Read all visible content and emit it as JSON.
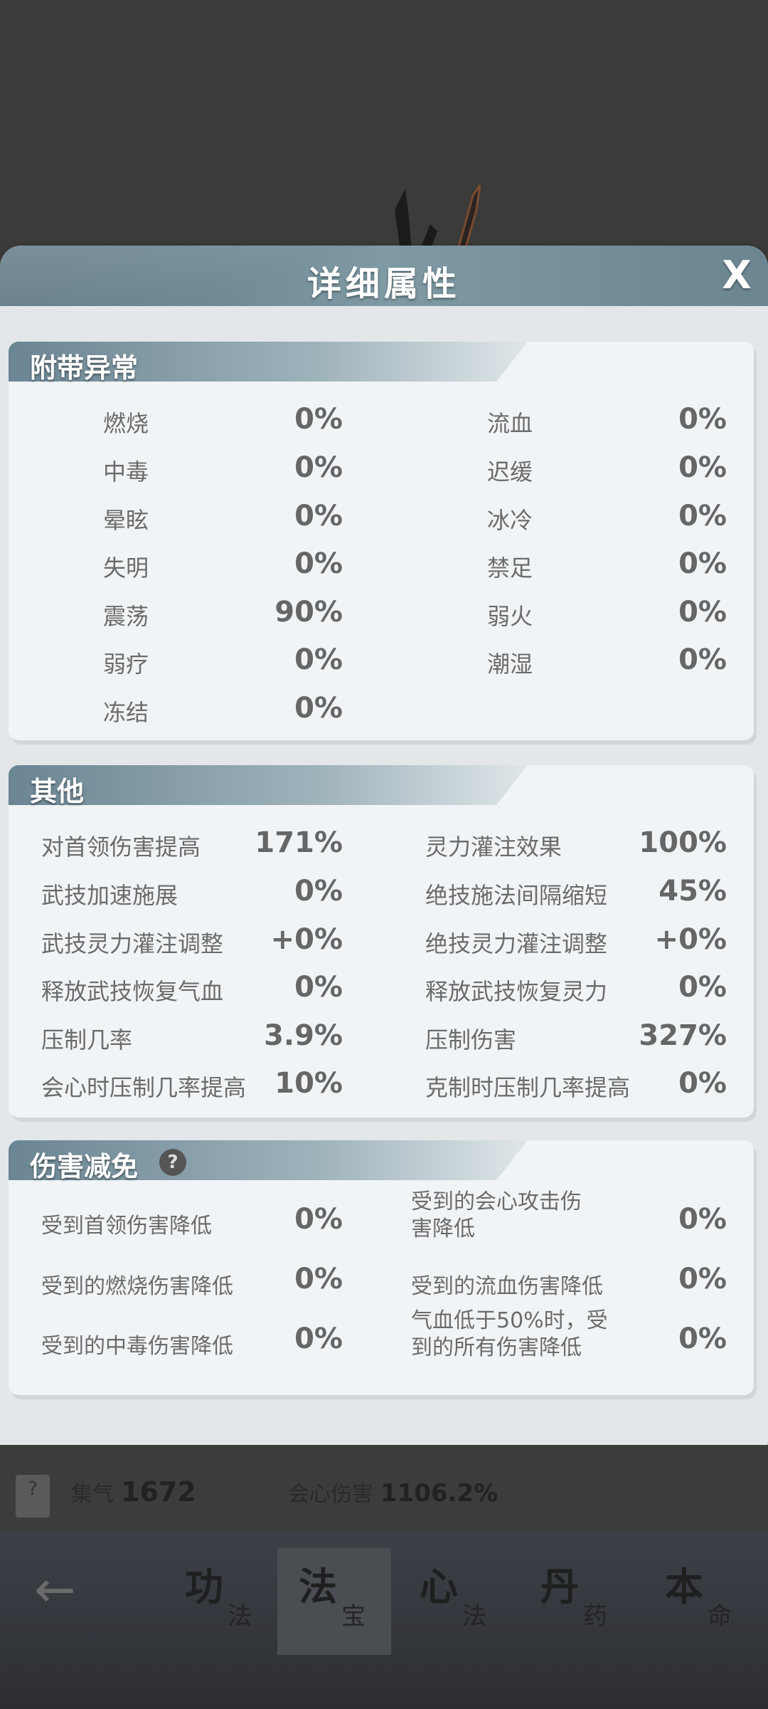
{
  "background": {
    "weapon_icon": "crossed-blades"
  },
  "panel": {
    "title": "详细属性",
    "close": "X"
  },
  "abnormal": {
    "title": "附带异常",
    "items": [
      {
        "label": "燃烧",
        "value": "0%"
      },
      {
        "label": "流血",
        "value": "0%"
      },
      {
        "label": "中毒",
        "value": "0%"
      },
      {
        "label": "迟缓",
        "value": "0%"
      },
      {
        "label": "晕眩",
        "value": "0%"
      },
      {
        "label": "冰冷",
        "value": "0%"
      },
      {
        "label": "失明",
        "value": "0%"
      },
      {
        "label": "禁足",
        "value": "0%"
      },
      {
        "label": "震荡",
        "value": "90%"
      },
      {
        "label": "弱火",
        "value": "0%"
      },
      {
        "label": "弱疗",
        "value": "0%"
      },
      {
        "label": "潮湿",
        "value": "0%"
      },
      {
        "label": "冻结",
        "value": "0%"
      }
    ]
  },
  "other": {
    "title": "其他",
    "items": [
      {
        "label": "对首领伤害提高",
        "value": "171%"
      },
      {
        "label": "灵力灌注效果",
        "value": "100%"
      },
      {
        "label": "武技加速施展",
        "value": "0%"
      },
      {
        "label": "绝技施法间隔缩短",
        "value": "45%"
      },
      {
        "label": "武技灵力灌注调整",
        "value": "+0%"
      },
      {
        "label": "绝技灵力灌注调整",
        "value": "+0%"
      },
      {
        "label": "释放武技恢复气血",
        "value": "0%"
      },
      {
        "label": "释放武技恢复灵力",
        "value": "0%"
      },
      {
        "label": "压制几率",
        "value": "3.9%"
      },
      {
        "label": "压制伤害",
        "value": "327%"
      },
      {
        "label": "会心时压制几率提高",
        "value": "10%"
      },
      {
        "label": "克制时压制几率提高",
        "value": "0%"
      }
    ]
  },
  "reduction": {
    "title": "伤害减免",
    "help": "?",
    "items": [
      {
        "label": "受到首领伤害降低",
        "value": "0%"
      },
      {
        "label": "受到的会心攻击伤害降低",
        "label_line1": "受到的会心攻击伤",
        "label_line2": "害降低",
        "value": "0%"
      },
      {
        "label": "受到的燃烧伤害降低",
        "value": "0%"
      },
      {
        "label": "受到的流血伤害降低",
        "value": "0%"
      },
      {
        "label": "受到的中毒伤害降低",
        "value": "0%"
      },
      {
        "label": "气血低于50%时，受到的所有伤害降低",
        "label_line1": "气血低于50%时，受",
        "label_line2": "到的所有伤害降低",
        "value": "0%"
      }
    ]
  },
  "strip": {
    "help": "?",
    "qi_label": "集气",
    "qi_value": "1672",
    "crit_label": "会心伤害",
    "crit_value": "1106.2%"
  },
  "nav": {
    "back": "←",
    "tabs": [
      {
        "big": "功",
        "small": "法"
      },
      {
        "big": "法",
        "small": "宝"
      },
      {
        "big": "心",
        "small": "法"
      },
      {
        "big": "丹",
        "small": "药"
      },
      {
        "big": "本",
        "small": "命"
      }
    ]
  }
}
